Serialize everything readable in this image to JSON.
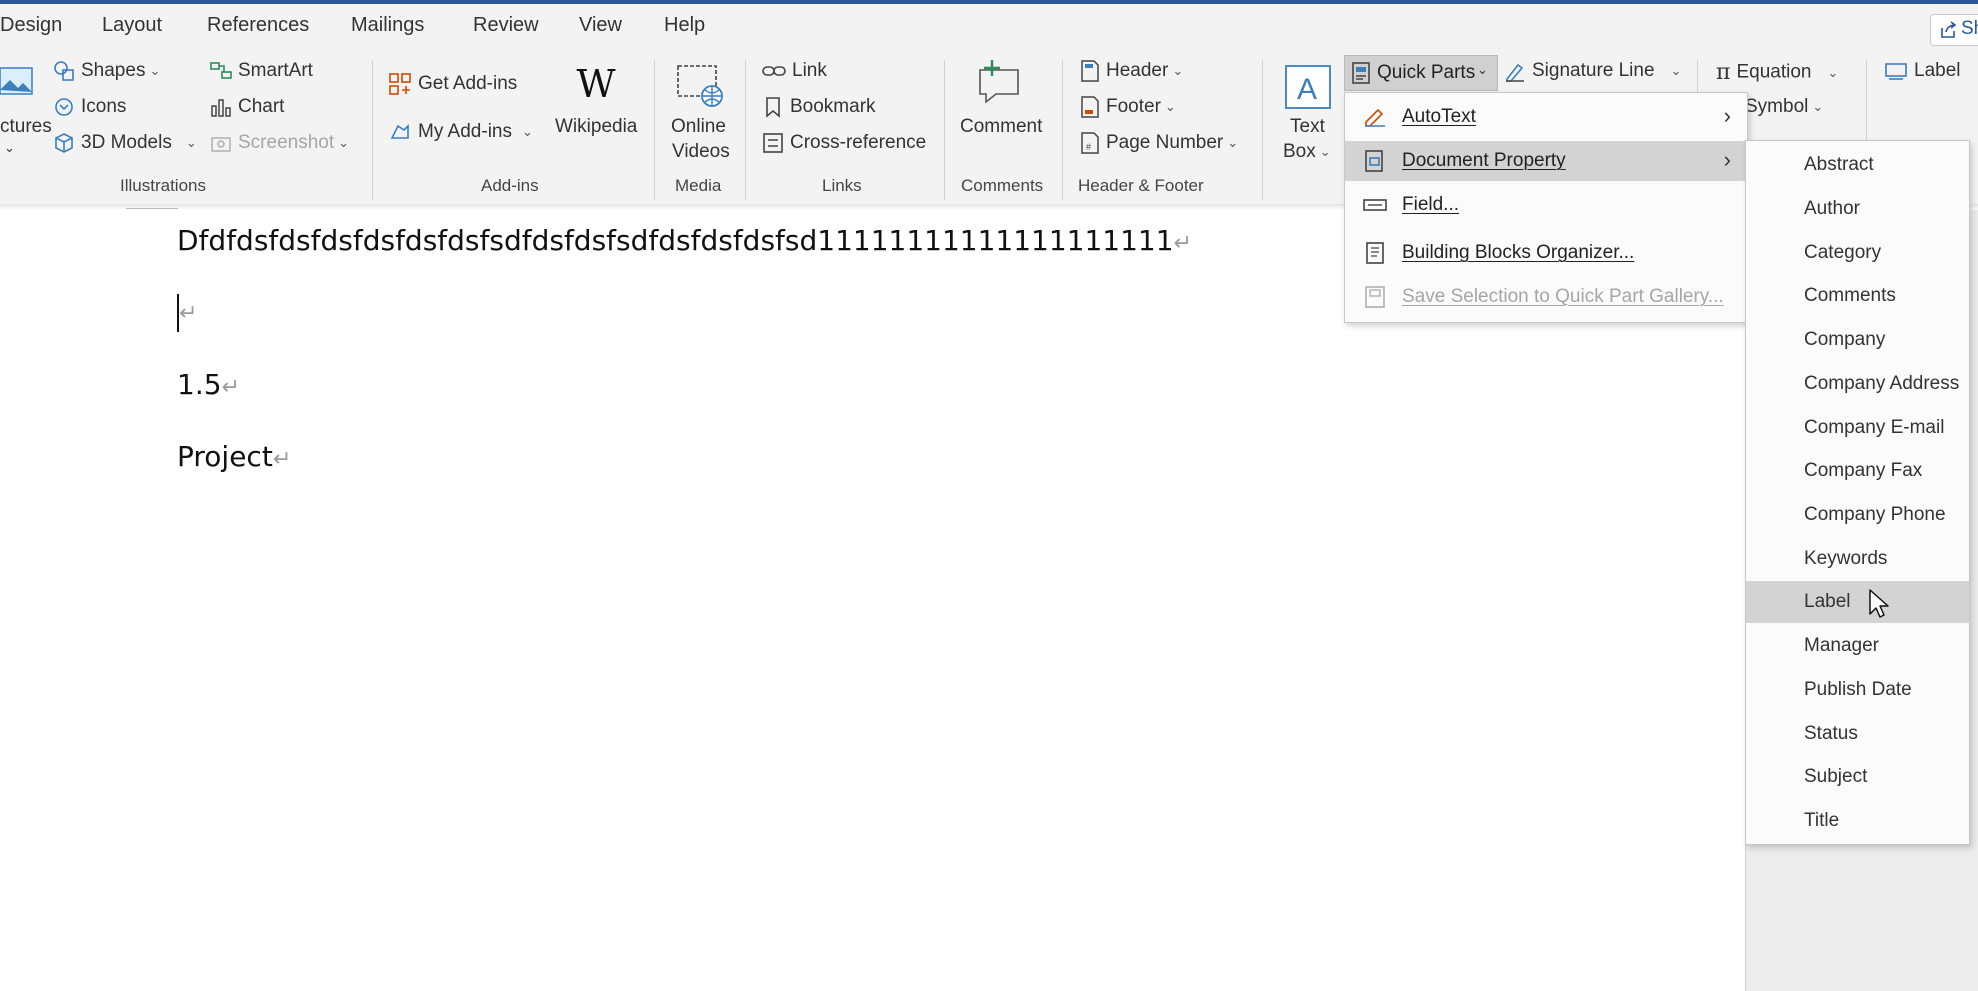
{
  "tabs": [
    "Design",
    "Layout",
    "References",
    "Mailings",
    "Review",
    "View",
    "Help"
  ],
  "share_label": "Sh",
  "illustrations": {
    "pictures_partial": "ctures",
    "shapes": "Shapes",
    "icons": "Icons",
    "models_3d": "3D Models",
    "smartart": "SmartArt",
    "chart": "Chart",
    "screenshot": "Screenshot",
    "group_label": "Illustrations"
  },
  "addins": {
    "get_addins": "Get Add-ins",
    "my_addins": "My Add-ins",
    "wikipedia": "Wikipedia",
    "group_label": "Add-ins"
  },
  "media": {
    "online_videos_1": "Online",
    "online_videos_2": "Videos",
    "group_label": "Media"
  },
  "links": {
    "link": "Link",
    "bookmark": "Bookmark",
    "cross_reference": "Cross-reference",
    "group_label": "Links"
  },
  "comments": {
    "comment": "Comment",
    "group_label": "Comments"
  },
  "header_footer": {
    "header": "Header",
    "footer": "Footer",
    "page_number": "Page Number",
    "group_label": "Header & Footer"
  },
  "text": {
    "text_box_1": "Text",
    "text_box_2": "Box",
    "quick_parts": "Quick Parts",
    "signature_line": "Signature Line"
  },
  "symbols": {
    "equation": "Equation",
    "symbol": "Symbol"
  },
  "far_right": {
    "label": "Label"
  },
  "document": {
    "lines": [
      "Dfdfdsfdsfdsfdsfdsfdsfsdfdsfdsfsdfdsfdsfdsfsd11111111111111111111",
      "",
      "1.5",
      "Project"
    ]
  },
  "quick_parts_menu": {
    "items": [
      {
        "label": "AutoText",
        "icon": "autotext-icon",
        "submenu": true
      },
      {
        "label": "Document Property",
        "icon": "document-property-icon",
        "submenu": true
      },
      {
        "label": "Field...",
        "icon": "field-icon",
        "submenu": false
      },
      {
        "label": "Building Blocks Organizer...",
        "icon": "building-blocks-icon",
        "submenu": false
      },
      {
        "label": "Save Selection to Quick Part Gallery...",
        "icon": "save-selection-icon",
        "submenu": false
      }
    ]
  },
  "document_property_submenu": {
    "items": [
      "Abstract",
      "Author",
      "Category",
      "Comments",
      "Company",
      "Company Address",
      "Company E-mail",
      "Company Fax",
      "Company Phone",
      "Keywords",
      "Label",
      "Manager",
      "Publish Date",
      "Status",
      "Subject",
      "Title"
    ],
    "highlighted": "Label"
  },
  "colors": {
    "accent": "#2b579a",
    "highlight": "#d3d3d3",
    "ribbon_bg": "#f3f3f3"
  }
}
